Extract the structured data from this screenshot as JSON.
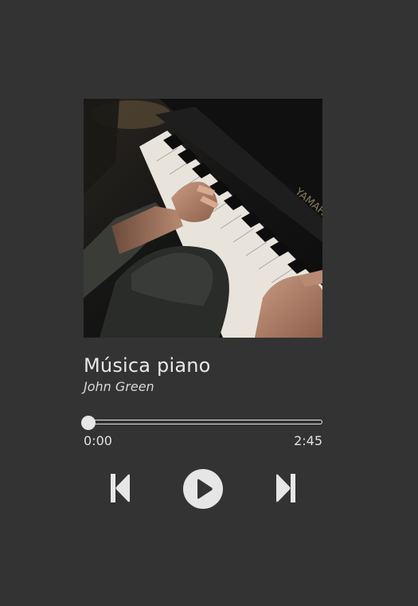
{
  "track": {
    "title": "Música piano",
    "artist": "John Green"
  },
  "cover": {
    "alt": "Hands playing piano",
    "piano_brand_text": "YAMAHA"
  },
  "playback": {
    "current_time": "0:00",
    "duration": "2:45",
    "progress": 0
  },
  "controls": {
    "previous_icon": "skip-previous-icon",
    "play_icon": "play-icon",
    "next_icon": "skip-next-icon"
  },
  "colors": {
    "background": "#333333",
    "foreground": "#e6e6e6"
  }
}
